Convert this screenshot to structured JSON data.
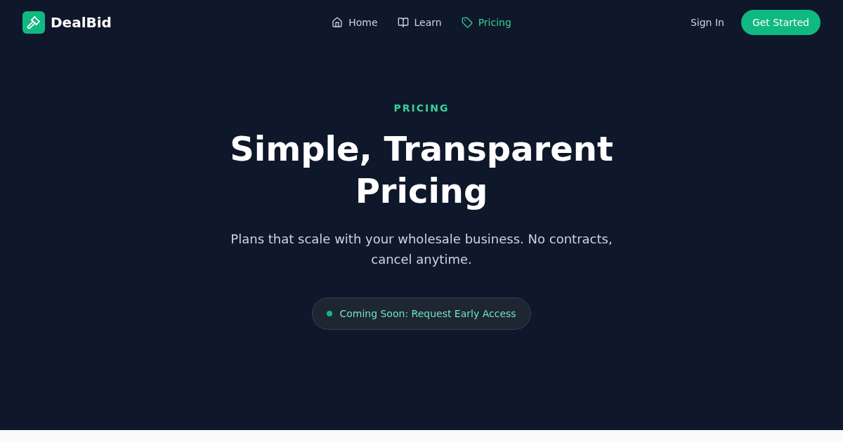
{
  "brand": {
    "name": "DealBid"
  },
  "nav": {
    "links": [
      {
        "label": "Home",
        "selected": false
      },
      {
        "label": "Learn",
        "selected": false
      },
      {
        "label": "Pricing",
        "selected": true
      }
    ]
  },
  "actions": {
    "sign_in": "Sign In",
    "get_started": "Get Started"
  },
  "hero": {
    "eyebrow": "PRICING",
    "title": "Simple, Transparent Pricing",
    "subtitle": "Plans that scale with your wholesale business. No contracts, cancel anytime.",
    "badge": {
      "label": "Coming Soon: Request Early Access"
    }
  }
}
